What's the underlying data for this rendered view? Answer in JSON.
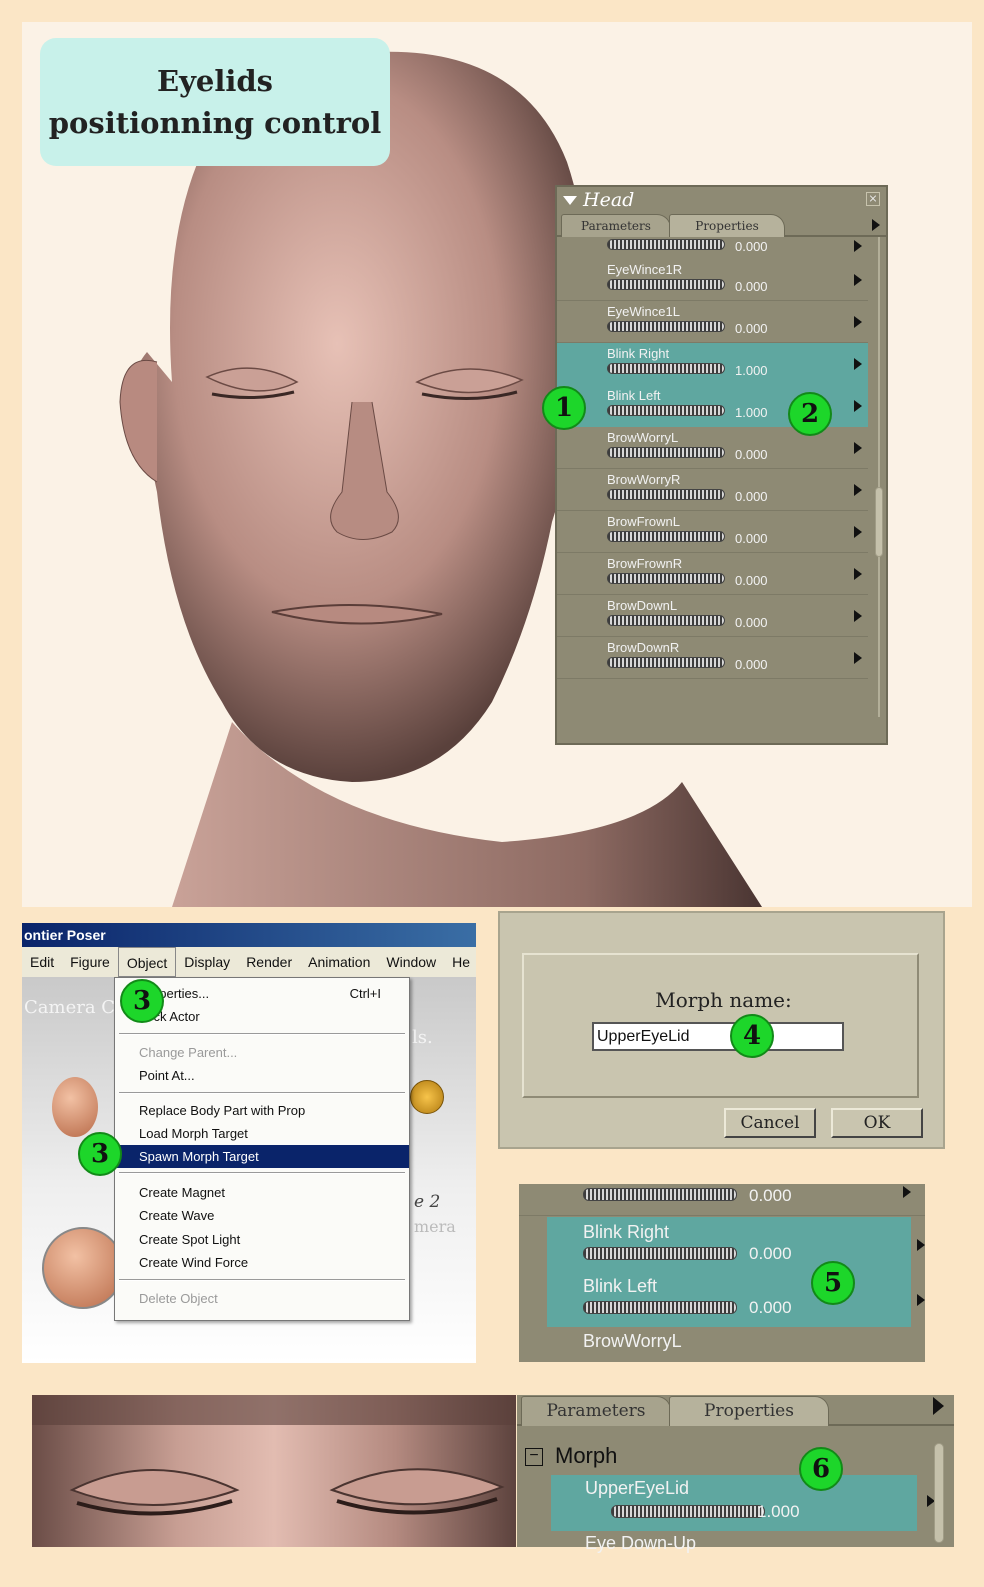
{
  "title": {
    "line1": "Eyelids",
    "line2": "positionning control"
  },
  "head_panel": {
    "title": "Head",
    "tabs": [
      "Parameters",
      "Properties"
    ],
    "params": [
      {
        "label": "EyeWince1R",
        "value": "0.000",
        "highlight": false
      },
      {
        "label": "EyeWince1L",
        "value": "0.000",
        "highlight": false
      },
      {
        "label": "Blink Right",
        "value": "1.000",
        "highlight": true
      },
      {
        "label": "Blink Left",
        "value": "1.000",
        "highlight": true
      },
      {
        "label": "BrowWorryL",
        "value": "0.000",
        "highlight": false
      },
      {
        "label": "BrowWorryR",
        "value": "0.000",
        "highlight": false
      },
      {
        "label": "BrowFrownL",
        "value": "0.000",
        "highlight": false
      },
      {
        "label": "BrowFrownR",
        "value": "0.000",
        "highlight": false
      },
      {
        "label": "BrowDownL",
        "value": "0.000",
        "highlight": false
      },
      {
        "label": "BrowDownR",
        "value": "0.000",
        "highlight": false
      }
    ],
    "top_cut_value": "0.000"
  },
  "badges": {
    "b1": "1",
    "b2": "2",
    "b3": "3",
    "b4": "4",
    "b5": "5",
    "b6": "6"
  },
  "menu_shot": {
    "app_title": "ontier Poser",
    "menubar": [
      "Edit",
      "Figure",
      "Object",
      "Display",
      "Render",
      "Animation",
      "Window",
      "He"
    ],
    "bg_text1": "Camera C",
    "bg_text2": "ls.",
    "bg_text3": "e 2",
    "bg_text4": "mera",
    "items": {
      "properties": "Properties...",
      "properties_short": "Ctrl+I",
      "lock_actor": "Lock Actor",
      "change_parent": "Change Parent...",
      "point_at": "Point At...",
      "replace_body": "Replace Body Part with Prop",
      "load_morph": "Load Morph Target",
      "spawn_morph": "Spawn Morph Target",
      "create_magnet": "Create Magnet",
      "create_wave": "Create Wave",
      "create_spot": "Create Spot Light",
      "create_wind": "Create Wind Force",
      "delete_object": "Delete Object"
    }
  },
  "dialog": {
    "label": "Morph name:",
    "input_value": "UpperEyeLid",
    "cancel": "Cancel",
    "ok": "OK"
  },
  "zoom_params": [
    {
      "label": "Blink Right",
      "value": "0.000"
    },
    {
      "label": "Blink Left",
      "value": "0.000"
    }
  ],
  "zoom_top_value": "0.000",
  "zoom_bottom_label": "BrowWorryL",
  "bottom_panel": {
    "tabs": [
      "Parameters",
      "Properties"
    ],
    "group": "Morph",
    "group_toggle": "−",
    "param": {
      "label": "UpperEyeLid",
      "value": "1.000"
    },
    "next_label": "Eye Down-Up"
  },
  "colors": {
    "highlight": "#5fa7a0",
    "badge": "#1dd62a",
    "panel": "#8e8a74"
  }
}
